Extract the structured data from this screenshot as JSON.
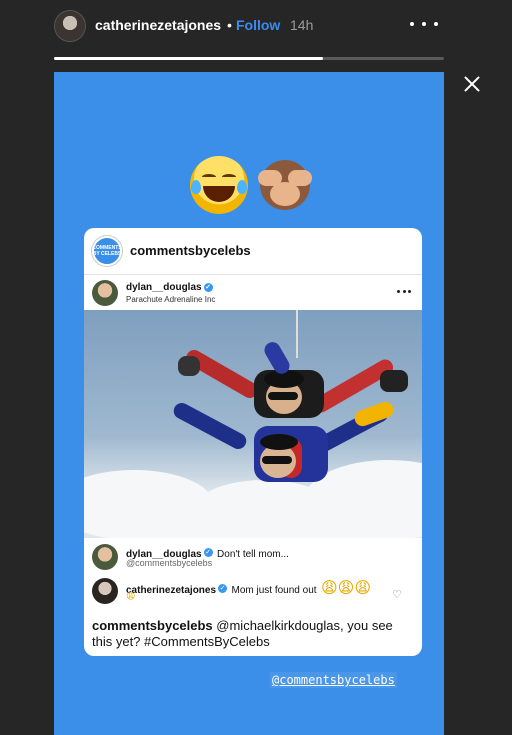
{
  "header": {
    "username": "catherinezetajones",
    "separator": "•",
    "follow_label": "Follow",
    "time_ago": "14h",
    "progress": 0.69
  },
  "story": {
    "background_color": "#3b8fe8",
    "emojis": [
      "face-with-tears-of-joy",
      "see-no-evil-monkey"
    ],
    "mention": "@commentsbycelebs"
  },
  "card": {
    "account": "commentsbycelebs",
    "logo_text": "COMMENTS BY CELEBS",
    "post": {
      "username": "dylan__douglas",
      "location": "Parachute Adrenaline Inc"
    },
    "comments": [
      {
        "username": "dylan__douglas",
        "text": "Don't tell mom...",
        "sub": "@commentsbycelebs"
      },
      {
        "username": "catherinezetajones",
        "text": "Mom just found out",
        "emoji_line": "😩😩😩",
        "emoji_line2": "😩"
      }
    ],
    "caption": {
      "username": "commentsbycelebs",
      "text": " @michaelkirkdouglas, you see this yet? #CommentsByCelebs"
    }
  },
  "colors": {
    "follow": "#3a8cf0",
    "verified": "#3897f0",
    "story_bg": "#3b8fe8"
  }
}
